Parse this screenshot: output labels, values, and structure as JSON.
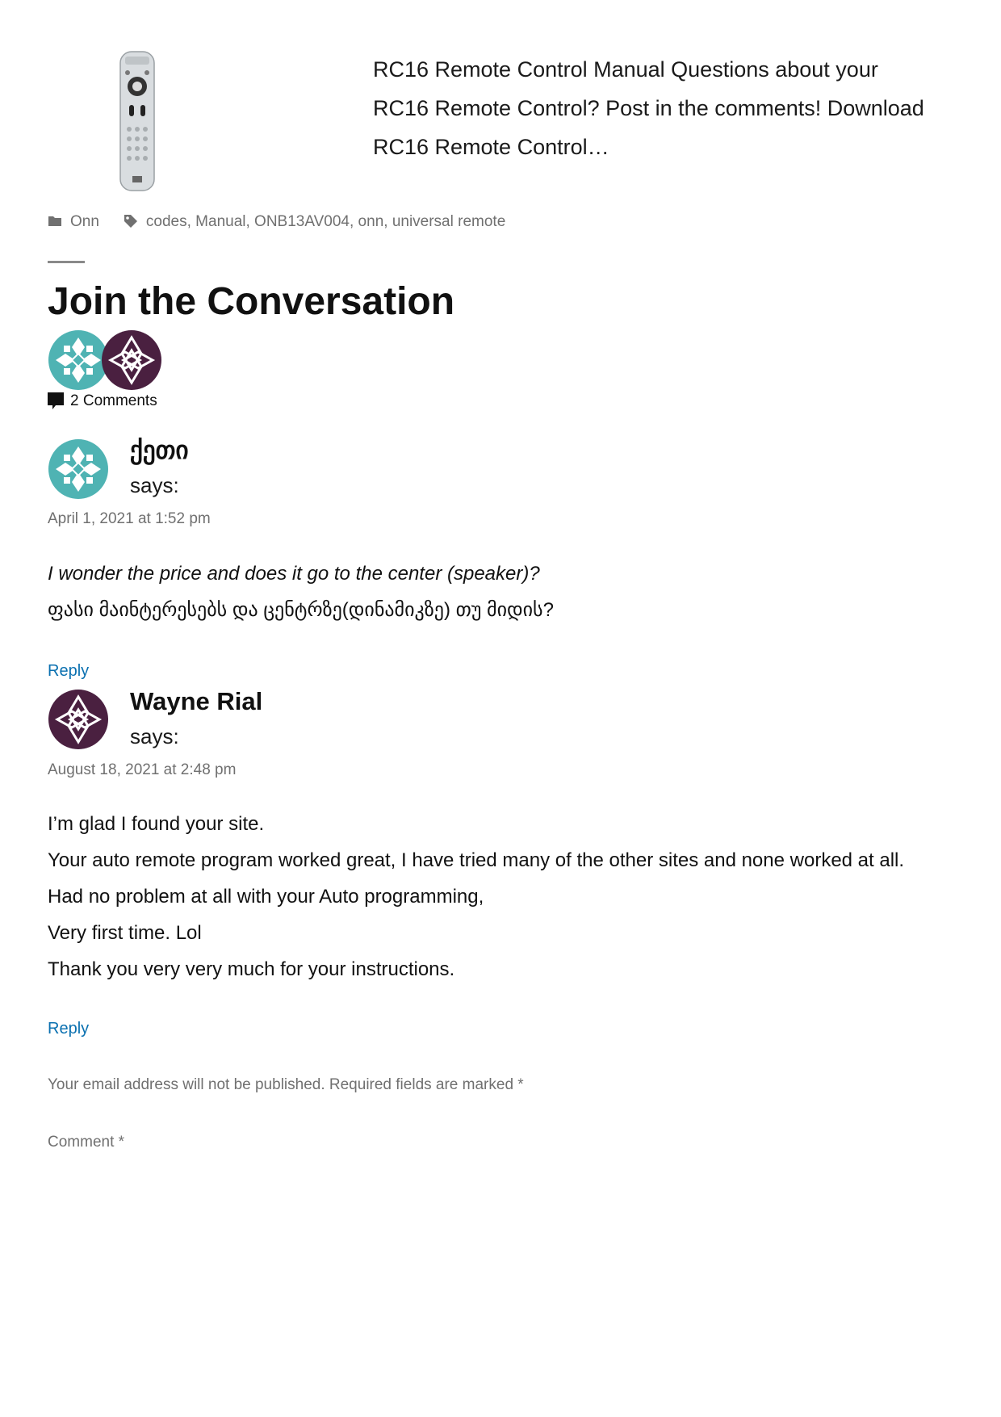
{
  "related": {
    "excerpt_lines": [
      "RC16 Remote Control Manual Questions about your",
      "RC16 Remote Control? Post in the comments! Download",
      "RC16 Remote Control…"
    ],
    "category": "Onn",
    "tags": "codes, Manual, ONB13AV004, onn, universal remote"
  },
  "conversation": {
    "title": "Join the Conversation",
    "comment_count": "2 Comments"
  },
  "comments": [
    {
      "author": "ქეთი",
      "says": "says:",
      "date": "April 1, 2021 at 1:52 pm",
      "body": [
        "I wonder the price and does it go to the center (speaker)?",
        "ფასი მაინტერესებს და ცენტრზე(დინამიკზე) თუ მიდის?"
      ],
      "reply": "Reply",
      "avatar_color": "#4fb3b3"
    },
    {
      "author": "Wayne Rial",
      "says": "says:",
      "date": "August 18, 2021 at 2:48 pm",
      "body": [
        "I’m glad I found your site.",
        "Your auto remote program worked great, I have tried many of the other sites and none worked at all.",
        "Had no problem at all with your Auto programming,",
        "Very first time. Lol",
        "Thank you very very much for your instructions."
      ],
      "reply": "Reply",
      "avatar_color": "#4a2040"
    }
  ],
  "form": {
    "note": "Your email address will not be published. Required fields are marked *",
    "comment_label": "Comment *"
  },
  "colors": {
    "link": "#0a70b0",
    "meta": "#707070"
  }
}
